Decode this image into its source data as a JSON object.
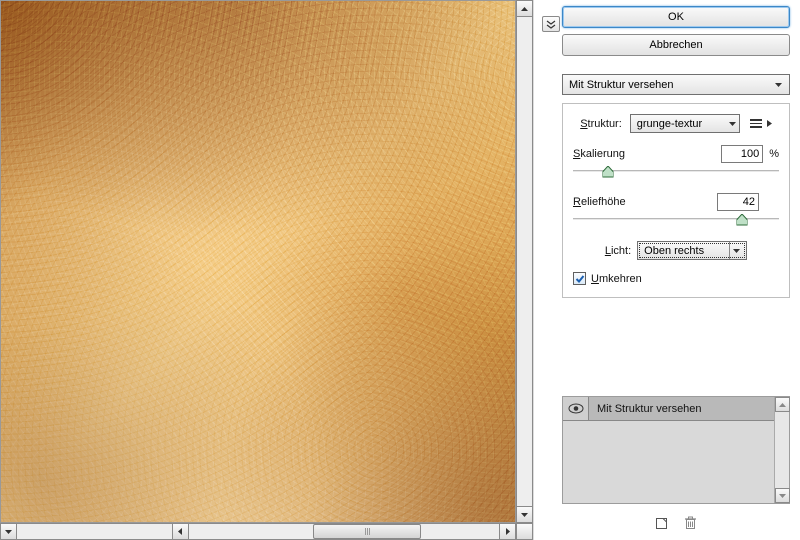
{
  "buttons": {
    "ok": "OK",
    "cancel": "Abbrechen"
  },
  "filter_select": {
    "value": "Mit Struktur versehen"
  },
  "structure": {
    "label": "Struktur:",
    "value": "grunge-textur"
  },
  "scaling": {
    "label": "Skalierung",
    "value": "100",
    "unit": "%",
    "pos": 17
  },
  "relief": {
    "label": "Reliefhöhe",
    "value": "42",
    "pos": 82
  },
  "light": {
    "label": "Licht:",
    "value": "Oben rechts"
  },
  "invert": {
    "label": "Umkehren",
    "checked": true
  },
  "layers": {
    "item0": "Mit Struktur versehen"
  }
}
